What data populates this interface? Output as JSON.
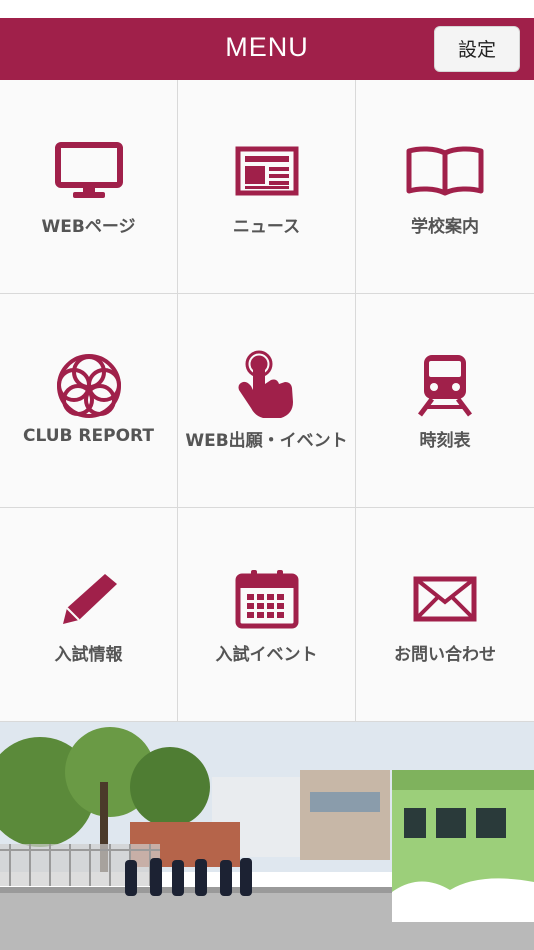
{
  "header": {
    "title": "MENU",
    "settings_label": "設定"
  },
  "menu": [
    {
      "label": "WEBページ",
      "icon": "monitor-icon"
    },
    {
      "label": "ニュース",
      "icon": "newspaper-icon"
    },
    {
      "label": "学校案内",
      "icon": "book-icon"
    },
    {
      "label": "CLUB  REPORT",
      "icon": "flower-icon"
    },
    {
      "label": "WEB出願・イベント",
      "icon": "tap-hand-icon"
    },
    {
      "label": "時刻表",
      "icon": "train-icon"
    },
    {
      "label": "入試情報",
      "icon": "pencil-icon"
    },
    {
      "label": "入試イベント",
      "icon": "calendar-icon"
    },
    {
      "label": "お問い合わせ",
      "icon": "mail-icon"
    }
  ],
  "colors": {
    "brand": "#a0204a",
    "label": "#555555",
    "grid_bg": "#fafafa"
  }
}
